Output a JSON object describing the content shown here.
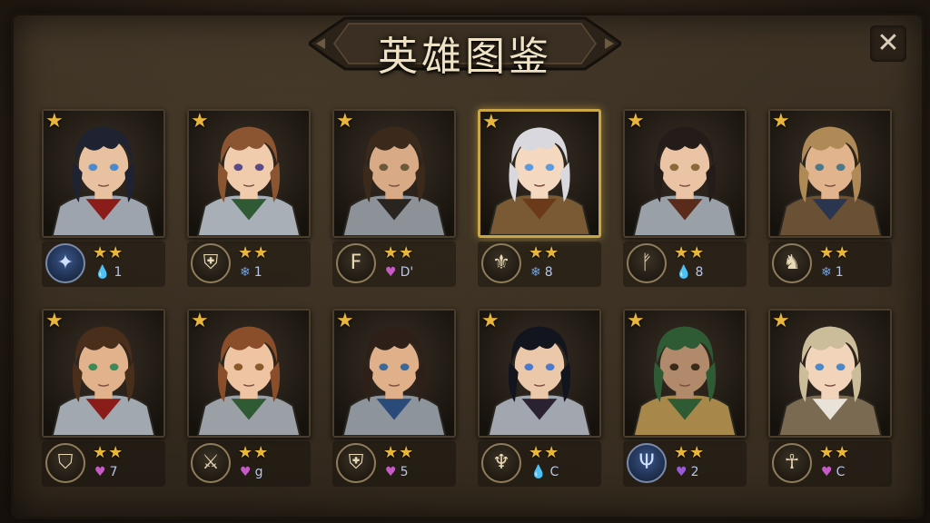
{
  "title": "英雄图鉴",
  "close_label": "✕",
  "heroes": [
    {
      "stat_icon": "💧",
      "stat_color": "#5f8fd8",
      "stat": "1",
      "emblem_icon": "compass-icon",
      "emblem_glyph": "✦",
      "blue": true,
      "hair": "#1f2230",
      "skin": "#e8c2a0",
      "eyes": "#4a8ad0",
      "armor": "#9ea4ad",
      "cape": "#8a1d1a",
      "selected": false
    },
    {
      "stat_icon": "❄",
      "stat_color": "#6aa3e6",
      "stat": "1",
      "emblem_icon": "shield-icon",
      "emblem_glyph": "⛨",
      "blue": false,
      "hair": "#8a5530",
      "skin": "#f0ccac",
      "eyes": "#5a4a8a",
      "armor": "#a9afb7",
      "cape": "#2f5a34",
      "selected": false
    },
    {
      "stat_icon": "♥",
      "stat_color": "#c85ac8",
      "stat": "D'",
      "emblem_icon": "crest-icon",
      "emblem_glyph": "F",
      "blue": false,
      "hair": "#3b2a1c",
      "skin": "#d8aa86",
      "eyes": "#6a5a3a",
      "armor": "#8d9198",
      "cape": "#2a2420",
      "selected": false
    },
    {
      "stat_icon": "❄",
      "stat_color": "#6aa3e6",
      "stat": "8",
      "emblem_icon": "fleur-icon",
      "emblem_glyph": "⚜",
      "blue": false,
      "hair": "#d8d8de",
      "skin": "#f4d8c0",
      "eyes": "#5a9ae0",
      "armor": "#7a5a34",
      "cape": "#6a3a1a",
      "selected": true
    },
    {
      "stat_icon": "💧",
      "stat_color": "#5f8fd8",
      "stat": "8",
      "emblem_icon": "rune-shield-icon",
      "emblem_glyph": "ᚠ",
      "blue": false,
      "hair": "#241c18",
      "skin": "#eac4a4",
      "eyes": "#8a6a3a",
      "armor": "#9aa0a8",
      "cape": "#5a2a1a",
      "selected": false
    },
    {
      "stat_icon": "❄",
      "stat_color": "#6aa3e6",
      "stat": "1",
      "emblem_icon": "horse-icon",
      "emblem_glyph": "♞",
      "blue": false,
      "hair": "#b08a56",
      "skin": "#e2b48e",
      "eyes": "#4a7a8a",
      "armor": "#6a5034",
      "cape": "#2a3650",
      "selected": false
    },
    {
      "stat_icon": "♥",
      "stat_color": "#c85ac8",
      "stat": "7",
      "emblem_icon": "shield-icon",
      "emblem_glyph": "⛉",
      "blue": false,
      "hair": "#4a2e1c",
      "skin": "#e2b28c",
      "eyes": "#3a8a5a",
      "armor": "#a2a8b0",
      "cape": "#8a1d1a",
      "selected": false
    },
    {
      "stat_icon": "♥",
      "stat_color": "#c85ac8",
      "stat": "g",
      "emblem_icon": "crossed-swords-icon",
      "emblem_glyph": "⚔",
      "blue": false,
      "hair": "#8a4e2a",
      "skin": "#eec4a2",
      "eyes": "#8a5a2a",
      "armor": "#9aa0a6",
      "cape": "#2f5a34",
      "selected": false
    },
    {
      "stat_icon": "♥",
      "stat_color": "#c85ac8",
      "stat": "5",
      "emblem_icon": "sword-shield-icon",
      "emblem_glyph": "⛨",
      "blue": false,
      "hair": "#2e2018",
      "skin": "#e0b08a",
      "eyes": "#3a6a9a",
      "armor": "#8e949c",
      "cape": "#2a4a7a",
      "selected": false
    },
    {
      "stat_icon": "💧",
      "stat_color": "#5f8fd8",
      "stat": "C",
      "emblem_icon": "goblet-icon",
      "emblem_glyph": "♆",
      "blue": false,
      "hair": "#12141e",
      "skin": "#ecc8aa",
      "eyes": "#4a7ad0",
      "armor": "#a2a6ae",
      "cape": "#2a2230",
      "selected": false
    },
    {
      "stat_icon": "♥",
      "stat_color": "#9a5ad8",
      "stat": "2",
      "emblem_icon": "trident-icon",
      "emblem_glyph": "Ψ",
      "blue": true,
      "hair": "#2e5a34",
      "skin": "#b08a6a",
      "eyes": "#3a2a1a",
      "armor": "#a8884a",
      "cape": "#2e5a34",
      "selected": false
    },
    {
      "stat_icon": "♥",
      "stat_color": "#c85ac8",
      "stat": "C",
      "emblem_icon": "dancer-icon",
      "emblem_glyph": "☥",
      "blue": false,
      "hair": "#cbbd9a",
      "skin": "#f2d4ba",
      "eyes": "#4a8ac8",
      "armor": "#7a6a52",
      "cape": "#e8e2d8",
      "selected": false
    }
  ]
}
